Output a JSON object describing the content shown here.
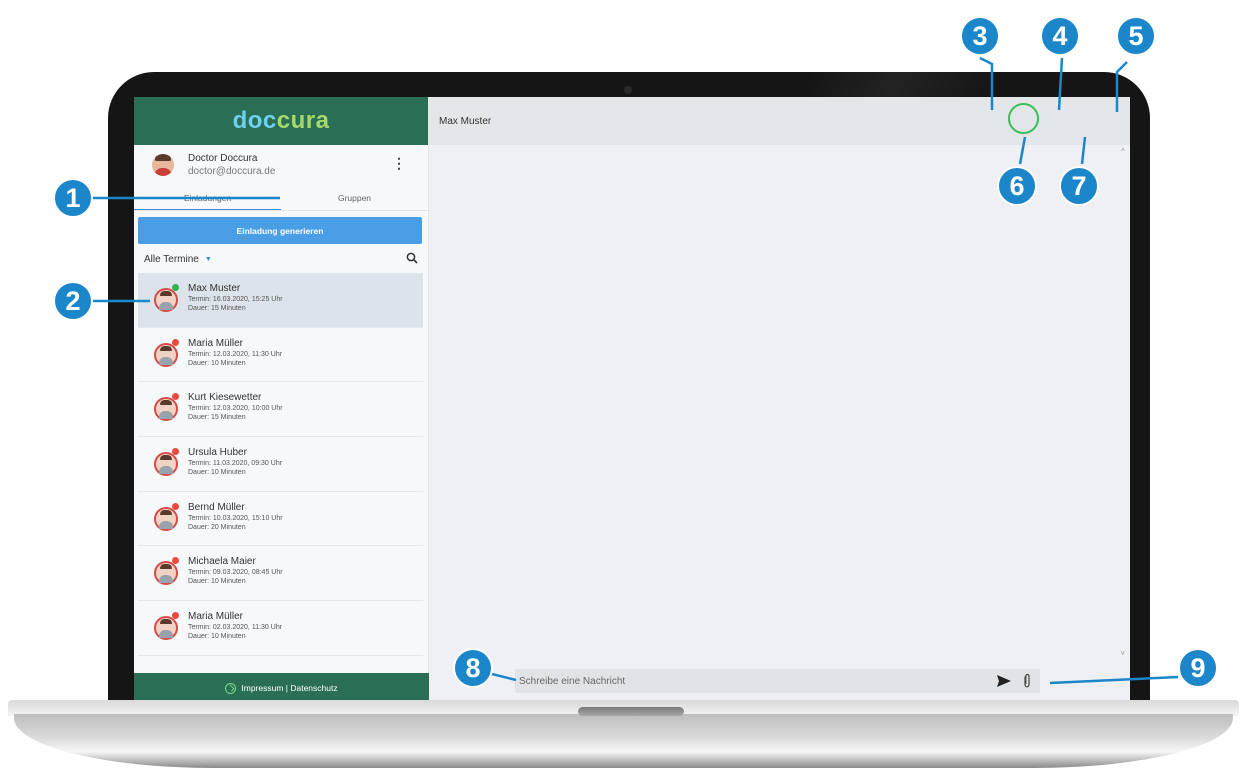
{
  "brand": {
    "logo_part1": "doc",
    "logo_part2": "cura",
    "logo_color1": "#6fd0f0",
    "logo_color2": "#a7d96a",
    "primary": "#2a6e55",
    "accent": "#4a9ee5"
  },
  "profile": {
    "name": "Doctor Doccura",
    "email": "doctor@doccura.de",
    "menu_icon": "kebab-icon"
  },
  "tabs": [
    {
      "label": "Einladungen",
      "active": true
    },
    {
      "label": "Gruppen",
      "active": false
    }
  ],
  "generate_button": "Einladung generieren",
  "filter": {
    "label": "Alle Termine",
    "icon": "search-icon"
  },
  "appointments": [
    {
      "name": "Max Muster",
      "termin": "Termin: 16.03.2020, 15:25 Uhr",
      "dauer": "Dauer: 15 Minuten",
      "status": "online",
      "selected": true
    },
    {
      "name": "Maria Müller",
      "termin": "Termin: 12.03.2020, 11:30 Uhr",
      "dauer": "Dauer: 10 Minuten",
      "status": "offline",
      "selected": false
    },
    {
      "name": "Kurt Kiesewetter",
      "termin": "Termin: 12.03.2020, 10:00 Uhr",
      "dauer": "Dauer: 15 Minuten",
      "status": "offline",
      "selected": false
    },
    {
      "name": "Ursula Huber",
      "termin": "Termin: 11.03.2020, 09:30 Uhr",
      "dauer": "Dauer: 10 Minuten",
      "status": "offline",
      "selected": false
    },
    {
      "name": "Bernd Müller",
      "termin": "Termin: 10.03.2020, 15:10 Uhr",
      "dauer": "Dauer: 20 Minuten",
      "status": "offline",
      "selected": false
    },
    {
      "name": "Michaela Maier",
      "termin": "Termin: 09.03.2020, 08:45 Uhr",
      "dauer": "Dauer: 10 Minuten",
      "status": "offline",
      "selected": false
    },
    {
      "name": "Maria Müller",
      "termin": "Termin: 02.03.2020, 11:30 Uhr",
      "dauer": "Dauer: 10 Minuten",
      "status": "offline",
      "selected": false
    }
  ],
  "footer": {
    "label": "Impressum | Datenschutz"
  },
  "chat": {
    "title": "Max Muster",
    "header_icons": [
      "phone-icon",
      "video-camera-icon",
      "cloud-download-icon",
      "info-icon",
      "kebab-icon"
    ],
    "composer_placeholder": "Schreibe eine Nachricht"
  },
  "callouts": [
    "1",
    "2",
    "3",
    "4",
    "5",
    "6",
    "7",
    "8",
    "9"
  ]
}
